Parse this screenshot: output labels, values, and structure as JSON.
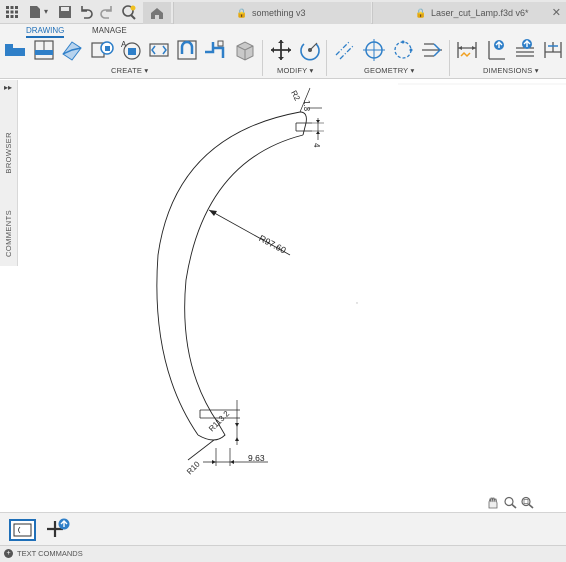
{
  "tabs": {
    "doc1": "something v3",
    "doc2": "Laser_cut_Lamp.f3d v6*"
  },
  "ribbon": {
    "tab_drawing": "DRAWING",
    "tab_manage": "MANAGE",
    "group_create": "CREATE ▾",
    "group_modify": "MODIFY ▾",
    "group_geometry": "GEOMETRY ▾",
    "group_dimensions": "DIMENSIONS ▾"
  },
  "sidebar": {
    "browser": "BROWSER",
    "comments": "COMMENTS"
  },
  "drawing": {
    "dim_r2": "R2",
    "dim_1_3": "1.3",
    "dim_4": "4",
    "dim_r97": "R97.60",
    "dim_r113": "R113.2",
    "dim_r10": "R10",
    "dim_9_63": "9.63"
  },
  "status": {
    "text_commands": "TEXT COMMANDS"
  },
  "colors": {
    "accent": "#1f6fb8",
    "ribbon_bg": "#f3f3f3"
  }
}
